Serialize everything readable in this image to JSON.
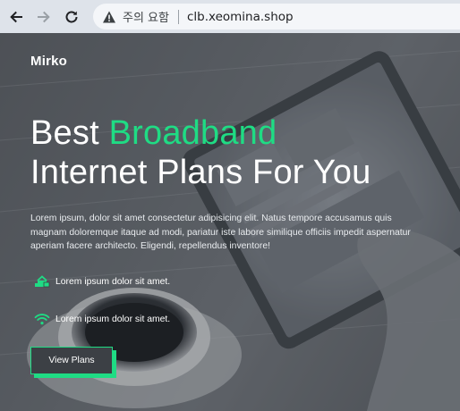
{
  "browser": {
    "back_icon": "arrow-left-icon",
    "forward_icon": "arrow-right-icon",
    "reload_icon": "reload-icon",
    "security_icon": "warning-triangle-icon",
    "security_label": "주의 요함",
    "url": "clb.xeomina.shop"
  },
  "site": {
    "brand": "Mirko"
  },
  "hero": {
    "headline_part1": "Best ",
    "headline_accent": "Broadband",
    "headline_line2": "Internet Plans For You",
    "lead": "Lorem ipsum, dolor sit amet consectetur adipisicing elit. Natus tempore accusamus quis magnam doloremque itaque ad modi, pariatur iste labore similique officiis impedit aspernatur aperiam facere architecto. Eligendi, repellendus inventore!",
    "features": [
      {
        "icon": "router-icon",
        "text": "Lorem ipsum dolor sit amet."
      },
      {
        "icon": "wifi-icon",
        "text": "Lorem ipsum dolor sit amet."
      }
    ],
    "cta_label": "View Plans"
  },
  "colors": {
    "accent": "#1fdc84",
    "chrome": "#dee3ea",
    "urlbar": "#f4f6f9",
    "text": "#ffffff"
  }
}
